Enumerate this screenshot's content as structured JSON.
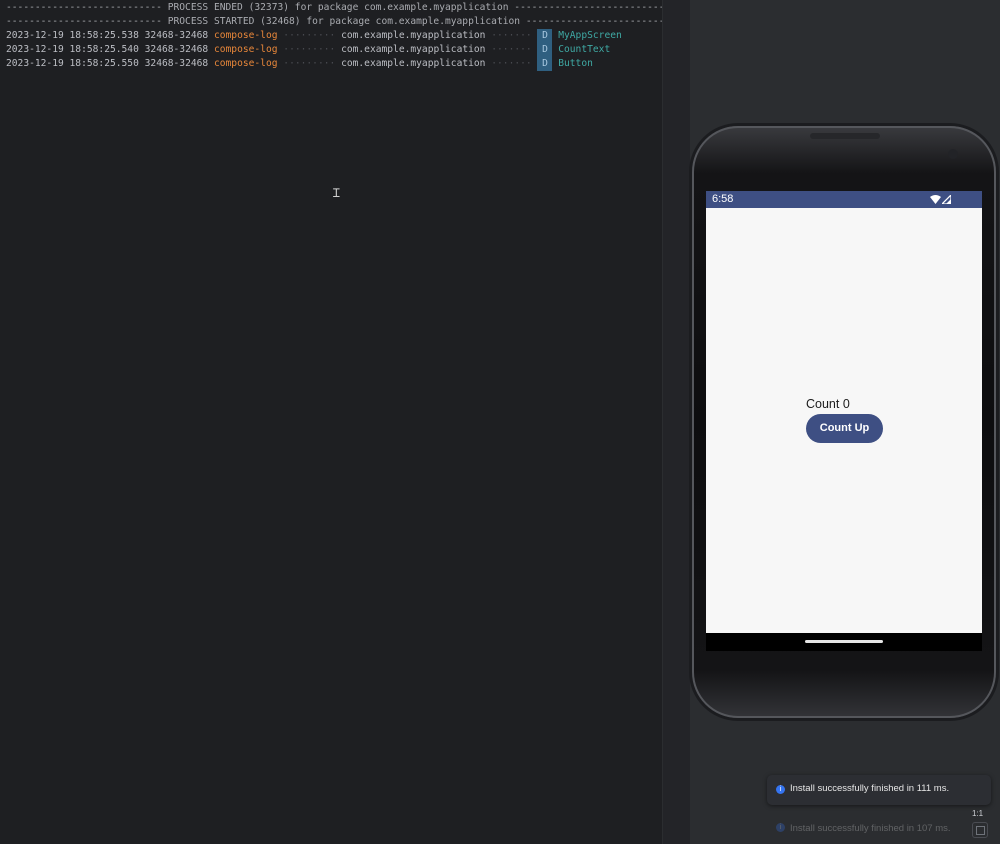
{
  "logcat": {
    "lines": [
      {
        "type": "separator",
        "dashes_left": "--------------------------- ",
        "text": "PROCESS ENDED (32373) for package com.example.myapplication",
        "dashes_right": " ----------------------------------"
      },
      {
        "type": "separator",
        "dashes_left": "--------------------------- ",
        "text": "PROCESS STARTED (32468) for package com.example.myapplication",
        "dashes_right": " ----------------------------------"
      },
      {
        "type": "entry",
        "timestamp": "2023-12-19 18:58:25.538",
        "pid": "32468-32468",
        "tag": "compose-log",
        "package": "com.example.myapplication",
        "level": "D",
        "message": "MyAppScreen"
      },
      {
        "type": "entry",
        "timestamp": "2023-12-19 18:58:25.540",
        "pid": "32468-32468",
        "tag": "compose-log",
        "package": "com.example.myapplication",
        "level": "D",
        "message": "CountText"
      },
      {
        "type": "entry",
        "timestamp": "2023-12-19 18:58:25.550",
        "pid": "32468-32468",
        "tag": "compose-log",
        "package": "com.example.myapplication",
        "level": "D",
        "message": "Button"
      }
    ]
  },
  "emulator": {
    "status_time": "6:58",
    "count_text": "Count 0",
    "count_button_label": "Count Up",
    "accent_color": "#3e4f83"
  },
  "notifications": {
    "toast1": "Install successfully finished in 111 ms.",
    "toast2": "Install successfully finished in 107 ms.",
    "info_icon": "i",
    "zoom_label": "1:1"
  }
}
